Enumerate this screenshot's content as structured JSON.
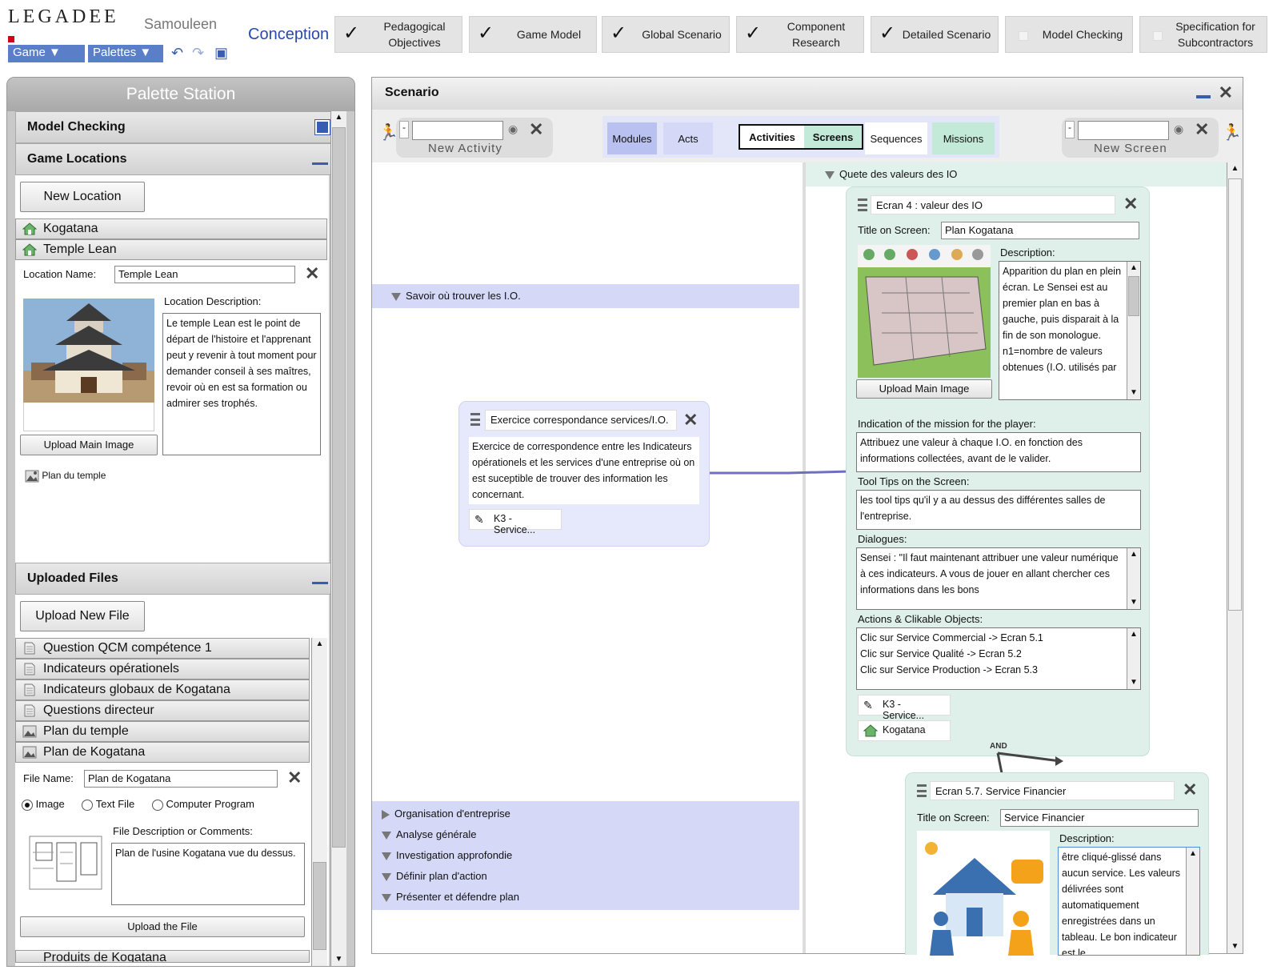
{
  "app": {
    "logo": "LEGADEE",
    "user": "Samouleen",
    "menu": {
      "game": "Game ▼",
      "palettes": "Palettes ▼"
    },
    "conception": "Conception"
  },
  "steps": [
    {
      "label": "Pedagogical Objectives",
      "checked": true
    },
    {
      "label": "Game Model",
      "checked": true
    },
    {
      "label": "Global Scenario",
      "checked": true
    },
    {
      "label": "Component Research",
      "checked": true
    },
    {
      "label": "Detailed Scenario",
      "checked": true
    },
    {
      "label": "Model Checking",
      "checked": false
    },
    {
      "label": "Specification for Subcontractors",
      "checked": false
    }
  ],
  "palette": {
    "title": "Palette Station",
    "model_checking": "Model Checking",
    "game_locations": "Game Locations",
    "new_location": "New Location",
    "locations": [
      "Kogatana",
      "Temple Lean"
    ],
    "location_name_label": "Location Name:",
    "location_name_value": "Temple Lean",
    "location_desc_label": "Location Description:",
    "location_desc": "Le temple Lean est le point de départ de l'histoire et l'apprenant peut y revenir à tout moment pour demander conseil à ses maîtres, revoir où en est sa formation ou admirer ses trophés.",
    "upload_main_image": "Upload Main Image",
    "linked_file": "Plan du temple",
    "uploaded_files": "Uploaded Files",
    "upload_new_file": "Upload New File",
    "files": [
      "Question QCM compétence 1",
      "Indicateurs opérationels",
      "Indicateurs globaux de Kogatana",
      "Questions directeur",
      "Plan du temple",
      "Plan de Kogatana"
    ],
    "file_name_label": "File Name:",
    "file_name_value": "Plan de Kogatana",
    "types": [
      "Image",
      "Text File",
      "Computer Program"
    ],
    "file_desc_label": "File Description or Comments:",
    "file_desc": "Plan de l'usine Kogatana vue du dessus.",
    "upload_the_file": "Upload the File",
    "next_file": "Produits de Kogatana"
  },
  "scenario": {
    "title": "Scenario",
    "new_activity": "New Activity",
    "new_screen": "New Screen",
    "tabs": [
      "Modules",
      "Acts",
      "Activities",
      "Screens",
      "Sequences",
      "Missions"
    ],
    "sequence_left": "Savoir où trouver les I.O.",
    "sequence_right": "Quete des valeurs des IO",
    "modules_list": [
      "Organisation d'entreprise",
      "Analyse générale",
      "Investigation approfondie",
      "Définir plan d'action",
      "Présenter et défendre plan"
    ],
    "activity": {
      "title": "Exercice correspondance services/I.O.",
      "desc": "Exercice de correspondence entre les Indicateurs opérationels et les services d'une entreprise où on est suceptible de trouver des information les concernant.",
      "tag": "K3 - Service..."
    },
    "screen1": {
      "title": "Ecran 4 : valeur des IO",
      "title_on_screen_label": "Title on Screen:",
      "title_on_screen": "Plan Kogatana",
      "description_label": "Description:",
      "description": "Apparition du plan en plein écran. Le Sensei est au premier plan en bas à gauche, puis disparait à la fin de son monologue. n1=nombre de valeurs obtenues (I.O. utilisés par",
      "upload": "Upload Main Image",
      "mission_label": "Indication of the mission for the player:",
      "mission": "Attribuez une valeur à chaque I.O. en fonction des informations collectées, avant de le valider.",
      "tooltips_label": "Tool Tips on the Screen:",
      "tooltips": "les tool tips qu'il y a au dessus des différentes salles de l'entreprise.",
      "dialogues_label": "Dialogues:",
      "dialogues": "Sensei : \"Il faut maintenant attribuer une valeur numérique à ces indicateurs. A vous de jouer en allant chercher ces informations dans les bons",
      "actions_label": "Actions & Clikable Objects:",
      "actions": [
        "Clic sur Service Commercial -> Ecran 5.1",
        "Clic sur Service Qualité -> Ecran 5.2",
        "Clic sur Service Production -> Ecran 5.3"
      ],
      "tag1": "K3 - Service...",
      "tag2": "Kogatana"
    },
    "and_label": "AND",
    "screen2": {
      "title": "Ecran 5.7.  Service Financier",
      "title_on_screen_label": "Title on Screen:",
      "title_on_screen": "Service Financier",
      "description_label": "Description:",
      "description": "être cliqué-glissé dans aucun service. Les valeurs délivrées sont automatiquement enregistrées dans un tableau. Le bon indicateur est le"
    }
  }
}
